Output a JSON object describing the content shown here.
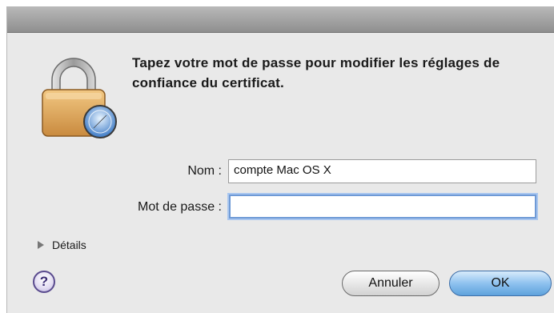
{
  "dialog": {
    "message": "Tapez votre mot de passe pour modifier les réglages de confiance du certificat."
  },
  "form": {
    "name_label": "Nom :",
    "name_value": "compte Mac OS X",
    "password_label": "Mot de passe :",
    "password_value": ""
  },
  "details": {
    "label": "Détails"
  },
  "help": {
    "label": "?"
  },
  "buttons": {
    "cancel": "Annuler",
    "ok": "OK"
  },
  "icons": {
    "lock": "padlock-with-safari-compass-icon",
    "details": "disclosure-triangle-icon",
    "help": "help-icon"
  },
  "colors": {
    "focus_ring": "#6f9ad6",
    "default_button": "#5ea2dc",
    "lock_body": "#e0a860"
  }
}
